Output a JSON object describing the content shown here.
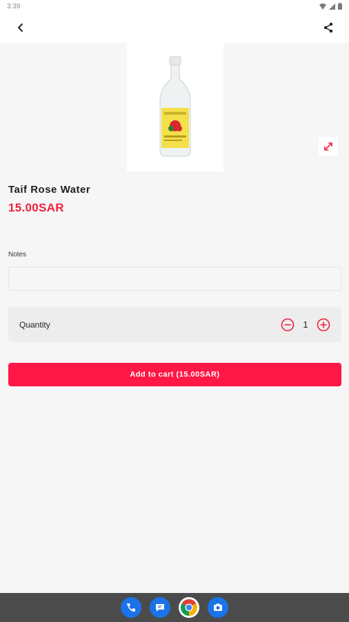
{
  "status_bar": {
    "time": "3:39",
    "icons": [
      "wifi-icon",
      "signal-icon",
      "battery-icon"
    ]
  },
  "app_bar": {
    "back_icon": "chevron-left-icon",
    "share_icon": "share-icon"
  },
  "product": {
    "image_icon": "rose-water-bottle",
    "name": "Taif Rose Water",
    "price": "15.00SAR",
    "expand_icon": "expand-icon"
  },
  "notes": {
    "label": "Notes",
    "value": "",
    "placeholder": ""
  },
  "quantity": {
    "label": "Quantity",
    "value": "1",
    "decrement_icon": "minus-circle-icon",
    "increment_icon": "plus-circle-icon"
  },
  "cart": {
    "button_label": "Add to cart (15.00SAR)"
  },
  "dock": {
    "apps": [
      "phone-icon",
      "messages-icon",
      "chrome-icon",
      "camera-icon"
    ]
  },
  "colors": {
    "accent": "#ff1746",
    "price": "#f0203f",
    "background": "#f6f6f6",
    "nav_bar": "#4b4b4b"
  }
}
